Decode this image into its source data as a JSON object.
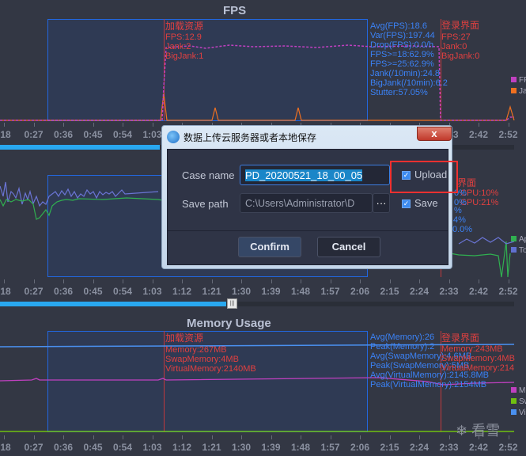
{
  "fps_panel": {
    "title": "FPS",
    "marker_left": {
      "name": "加载资源",
      "lines": [
        "FPS:12.9",
        "Jank:2",
        "BigJank:1"
      ]
    },
    "marker_right": {
      "name": "登录界面",
      "lines": [
        "FPS:27",
        "Jank:0",
        "BigJank:0"
      ]
    },
    "stats": [
      "Avg(FPS):18.6",
      "Var(FPS):197.44",
      "Drop(FPS):0.0/h",
      "FPS>=18:62.9%",
      "FPS>=25:62.9%",
      "Jank(/10min):24.8",
      "BigJank(/10min):6.2",
      "Stutter:57.05%"
    ],
    "legend": [
      {
        "label": "FP",
        "color": "#c040c0"
      },
      {
        "label": "Jai",
        "color": "#f07020"
      }
    ]
  },
  "cpu_panel": {
    "marker_right_fragments": [
      "界面",
      "CPU:10%",
      "CPU:21%"
    ],
    "stats_fragments": [
      "0%",
      "0%",
      "%",
      "4%",
      "0.0%"
    ],
    "legend": [
      {
        "label": "Ap",
        "color": "#30b050"
      },
      {
        "label": "To",
        "color": "#6070d0"
      }
    ]
  },
  "memory_panel": {
    "title": "Memory Usage",
    "marker_left": {
      "name": "加载资源",
      "lines": [
        "Memory:267MB",
        "SwapMemory:4MB",
        "VirtualMemory:2140MB"
      ]
    },
    "marker_right": {
      "name": "登录界面",
      "lines": [
        "Memory:243MB",
        "SwapMemory:4MB",
        "VirtualMemory:214"
      ]
    },
    "stats": [
      "Avg(Memory):26",
      "Peak(Memory):2",
      "Avg(SwapMemory):4.6MB",
      "Peak(SwapMemory):5MB",
      "Avg(VirtualMemory):2145.8MB",
      "Peak(VirtualMemory):2154MB"
    ],
    "legend": [
      {
        "label": "M",
        "color": "#c040c0"
      },
      {
        "label": "Sw",
        "color": "#70c010"
      },
      {
        "label": "Vi",
        "color": "#4a90f0"
      }
    ]
  },
  "time_ticks": [
    ":18",
    "0:27",
    "0:36",
    "0:45",
    "0:54",
    "1:03",
    "1:12",
    "1:21",
    "1:30",
    "1:39",
    "1:48",
    "1:57",
    "2:06",
    "2:15",
    "2:24",
    "2:33",
    "2:42",
    "2:52"
  ],
  "scroll": {
    "fps_progress": 0.31,
    "cpu_progress": 0.44
  },
  "dialog": {
    "title": "数据上传云服务器或者本地保存",
    "close_icon": "x",
    "case_name_label": "Case name",
    "case_name_value": "PD_20200521_18_00_05",
    "save_path_label": "Save path",
    "save_path_value": "C:\\Users\\Administrator\\D",
    "browse_label": "···",
    "upload_label": "Upload",
    "upload_checked": true,
    "save_label": "Save",
    "save_checked": true,
    "confirm_label": "Confirm",
    "cancel_label": "Cancel"
  },
  "watermark": "看雪"
}
